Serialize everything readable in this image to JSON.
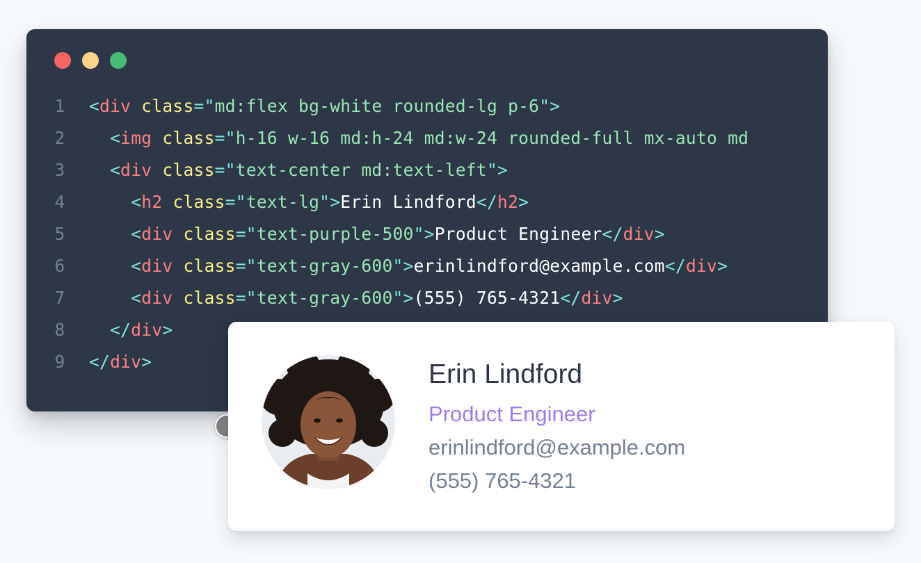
{
  "code_window": {
    "lines": [
      {
        "number": "1",
        "tokens": [
          [
            "p",
            "<"
          ],
          [
            "t",
            "div"
          ],
          [
            "x",
            " "
          ],
          [
            "a",
            "class"
          ],
          [
            "p",
            "=\""
          ],
          [
            "s",
            "md:flex bg-white rounded-lg p-6"
          ],
          [
            "p",
            "\">"
          ]
        ]
      },
      {
        "number": "2",
        "tokens": [
          [
            "x",
            "  "
          ],
          [
            "p",
            "<"
          ],
          [
            "t",
            "img"
          ],
          [
            "x",
            " "
          ],
          [
            "a",
            "class"
          ],
          [
            "p",
            "=\""
          ],
          [
            "s",
            "h-16 w-16 md:h-24 md:w-24 rounded-full mx-auto md"
          ]
        ]
      },
      {
        "number": "3",
        "tokens": [
          [
            "x",
            "  "
          ],
          [
            "p",
            "<"
          ],
          [
            "t",
            "div"
          ],
          [
            "x",
            " "
          ],
          [
            "a",
            "class"
          ],
          [
            "p",
            "=\""
          ],
          [
            "s",
            "text-center md:text-left"
          ],
          [
            "p",
            "\">"
          ]
        ]
      },
      {
        "number": "4",
        "tokens": [
          [
            "x",
            "    "
          ],
          [
            "p",
            "<"
          ],
          [
            "t",
            "h2"
          ],
          [
            "x",
            " "
          ],
          [
            "a",
            "class"
          ],
          [
            "p",
            "=\""
          ],
          [
            "s",
            "text-lg"
          ],
          [
            "p",
            "\">"
          ],
          [
            "x",
            "Erin Lindford"
          ],
          [
            "p",
            "</"
          ],
          [
            "t",
            "h2"
          ],
          [
            "p",
            ">"
          ]
        ]
      },
      {
        "number": "5",
        "tokens": [
          [
            "x",
            "    "
          ],
          [
            "p",
            "<"
          ],
          [
            "t",
            "div"
          ],
          [
            "x",
            " "
          ],
          [
            "a",
            "class"
          ],
          [
            "p",
            "=\""
          ],
          [
            "s",
            "text-purple-500"
          ],
          [
            "p",
            "\">"
          ],
          [
            "x",
            "Product Engineer"
          ],
          [
            "p",
            "</"
          ],
          [
            "t",
            "div"
          ],
          [
            "p",
            ">"
          ]
        ]
      },
      {
        "number": "6",
        "tokens": [
          [
            "x",
            "    "
          ],
          [
            "p",
            "<"
          ],
          [
            "t",
            "div"
          ],
          [
            "x",
            " "
          ],
          [
            "a",
            "class"
          ],
          [
            "p",
            "=\""
          ],
          [
            "s",
            "text-gray-600"
          ],
          [
            "p",
            "\">"
          ],
          [
            "x",
            "erinlindford@example.com"
          ],
          [
            "p",
            "</"
          ],
          [
            "t",
            "div"
          ],
          [
            "p",
            ">"
          ]
        ]
      },
      {
        "number": "7",
        "tokens": [
          [
            "x",
            "    "
          ],
          [
            "p",
            "<"
          ],
          [
            "t",
            "div"
          ],
          [
            "x",
            " "
          ],
          [
            "a",
            "class"
          ],
          [
            "p",
            "=\""
          ],
          [
            "s",
            "text-gray-600"
          ],
          [
            "p",
            "\">"
          ],
          [
            "x",
            "(555) 765-4321"
          ],
          [
            "p",
            "</"
          ],
          [
            "t",
            "div"
          ],
          [
            "p",
            ">"
          ]
        ]
      },
      {
        "number": "8",
        "tokens": [
          [
            "x",
            "  "
          ],
          [
            "p",
            "</"
          ],
          [
            "t",
            "div"
          ],
          [
            "p",
            ">"
          ]
        ]
      },
      {
        "number": "9",
        "tokens": [
          [
            "p",
            "</"
          ],
          [
            "t",
            "div"
          ],
          [
            "p",
            ">"
          ]
        ]
      }
    ]
  },
  "profile_card": {
    "avatar_icon": "person-portrait-icon",
    "name": "Erin Lindford",
    "title": "Product Engineer",
    "email": "erinlindford@example.com",
    "phone": "(555) 765-4321"
  },
  "colors": {
    "editor_bg": "#2d3748",
    "punctuation": "#81e6d9",
    "tag": "#fc8181",
    "attribute": "#faf089",
    "string": "#9ae6b4",
    "title_purple": "#9f7aea",
    "muted_gray": "#718096"
  }
}
